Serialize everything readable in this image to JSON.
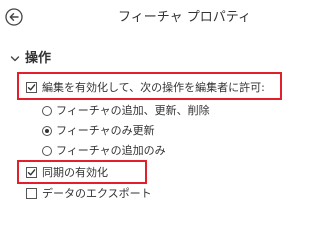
{
  "header": {
    "back_icon": "back-arrow-icon",
    "title": "フィーチャ プロパティ"
  },
  "section": {
    "chevron_icon": "chevron-down-icon",
    "title": "操作",
    "enable_editing": {
      "label": "編集を有効化して、次の操作を編集者に許可:",
      "checked": true
    },
    "radio_options": [
      {
        "label": "フィーチャの追加、更新、削除",
        "selected": false
      },
      {
        "label": "フィーチャのみ更新",
        "selected": true
      },
      {
        "label": "フィーチャの追加のみ",
        "selected": false
      }
    ],
    "enable_sync": {
      "label": "同期の有効化",
      "checked": true
    },
    "export_data": {
      "label": "データのエクスポート",
      "checked": false
    }
  },
  "colors": {
    "highlight": "#e0202a",
    "text": "#333333",
    "control_border": "#555555"
  }
}
